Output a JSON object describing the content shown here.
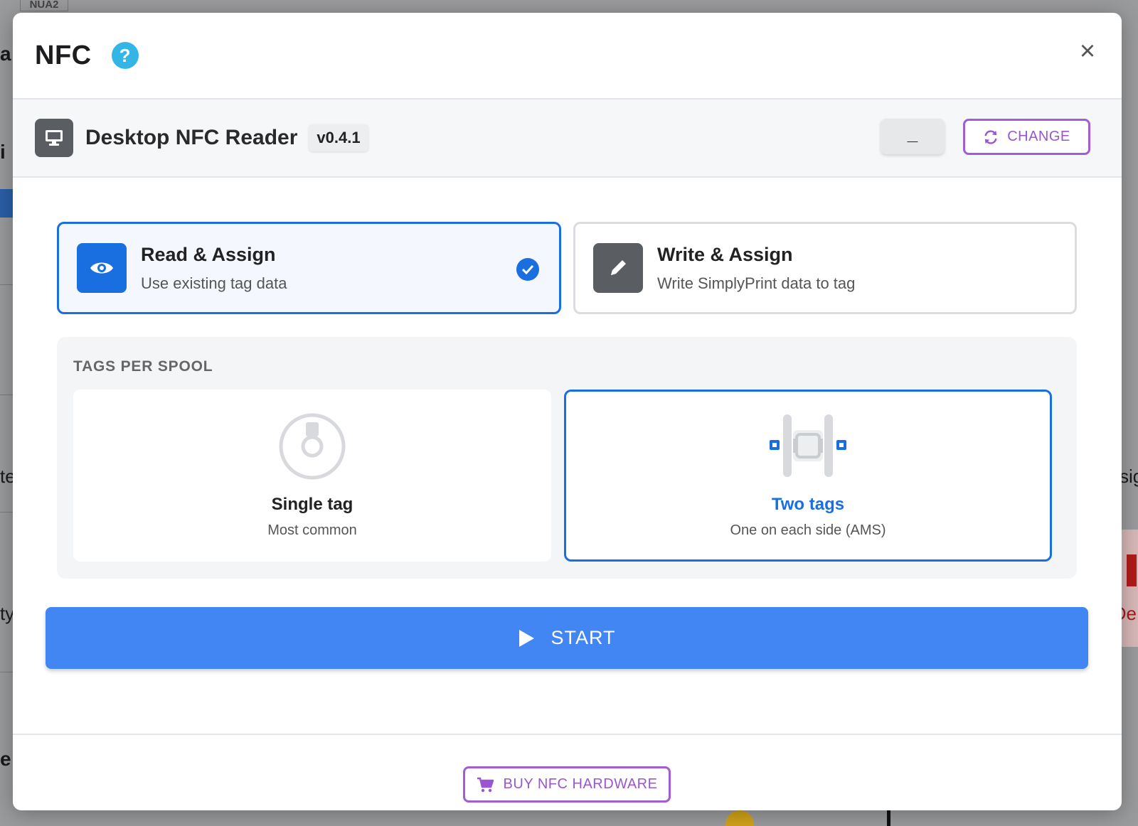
{
  "background": {
    "tab_label": "NUA2",
    "fragments": [
      "a",
      "i",
      "te",
      "ty",
      "e",
      "sig",
      "De"
    ]
  },
  "modal": {
    "title": "NFC",
    "help_icon": "question-circle-icon",
    "close_icon": "close-icon"
  },
  "device": {
    "icon": "monitor-icon",
    "name": "Desktop NFC Reader",
    "version": "v0.4.1",
    "minimize_label": "_",
    "change_label": "CHANGE",
    "change_icon": "sync-icon"
  },
  "modes": [
    {
      "title": "Read & Assign",
      "subtitle": "Use existing tag data",
      "icon": "eye-icon",
      "selected": true
    },
    {
      "title": "Write & Assign",
      "subtitle": "Write SimplyPrint data to tag",
      "icon": "pencil-icon",
      "selected": false
    }
  ],
  "tags_per_spool": {
    "label": "TAGS PER SPOOL",
    "options": [
      {
        "title": "Single tag",
        "subtitle": "Most common",
        "selected": false
      },
      {
        "title": "Two tags",
        "subtitle": "One on each side (AMS)",
        "selected": true
      }
    ]
  },
  "start": {
    "label": "START",
    "icon": "play-icon"
  },
  "footer": {
    "buy_label": "BUY NFC HARDWARE",
    "buy_icon": "cart-icon"
  },
  "colors": {
    "primary_blue": "#1a6fe0",
    "start_blue": "#4286f4",
    "accent_purple": "#a15cd6",
    "help_blue": "#33b5e5"
  }
}
